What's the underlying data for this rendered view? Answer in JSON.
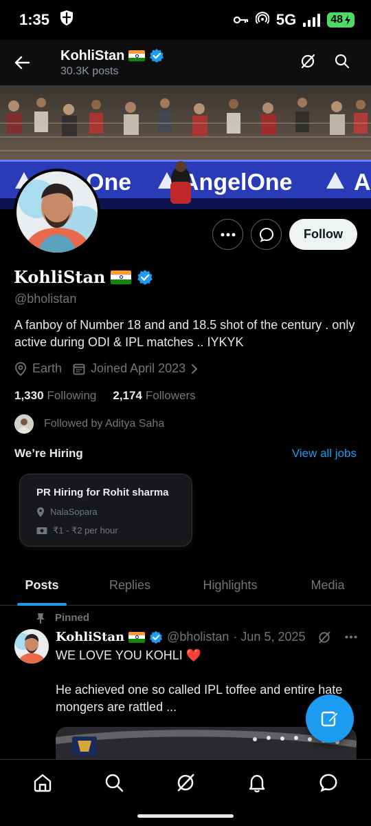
{
  "status_bar": {
    "time": "1:35",
    "network": "5G",
    "battery": "48"
  },
  "header": {
    "name": "KohliStan",
    "posts_count": "30.3K posts"
  },
  "profile": {
    "name": "KohliStan",
    "handle": "@bholistan",
    "bio": "A fanboy of Number 18 and and 18.5 shot of the century . only active during ODI & IPL matches .. IYKYK",
    "location": "Earth",
    "joined": "Joined April 2023",
    "following_count": "1,330",
    "following_label": "Following",
    "followers_count": "2,174",
    "followers_label": "Followers",
    "followed_by": "Followed by Aditya Saha",
    "follow_label": "Follow"
  },
  "banner": {
    "sponsor_text": "AngelOne"
  },
  "hiring": {
    "title": "We’re Hiring",
    "view_all": "View all jobs",
    "job": {
      "title": "PR Hiring for Rohit sharma",
      "location": "NalaSopara",
      "salary": "₹1 - ₹2 per hour"
    }
  },
  "tabs": [
    {
      "label": "Posts",
      "active": true
    },
    {
      "label": "Replies",
      "active": false
    },
    {
      "label": "Highlights",
      "active": false
    },
    {
      "label": "Media",
      "active": false
    }
  ],
  "post": {
    "pinned_label": "Pinned",
    "author_name": "KohliStan",
    "author_handle": "@bholistan",
    "date": "· Jun 5, 2025",
    "text": "WE LOVE YOU KOHLI ❤️\n\nHe achieved one so called IPL toffee and entire hate mongers are rattled ..."
  },
  "bottom_nav": [
    "home-icon",
    "search-icon",
    "grok-icon",
    "notifications-icon",
    "messages-icon"
  ],
  "colors": {
    "accent": "#1d9bf0",
    "background": "#000000",
    "muted_text": "#71767b",
    "verified": "#1d9bf0"
  }
}
